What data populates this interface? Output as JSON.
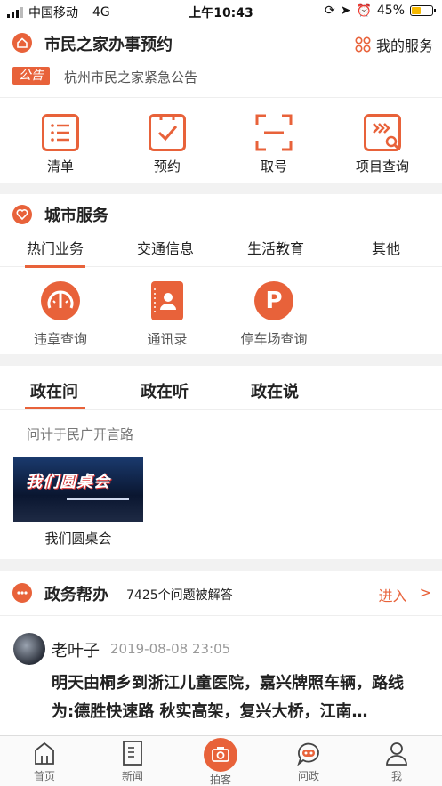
{
  "status_bar": {
    "carrier": "中国移动",
    "network": "4G",
    "time": "上午10:43",
    "battery": "45%"
  },
  "header": {
    "title": "市民之家办事预约",
    "my_services": "我的服务"
  },
  "notice": {
    "badge": "公告",
    "text": "杭州市民之家紧急公告"
  },
  "quick_actions": [
    {
      "label": "清单",
      "icon": "list-icon"
    },
    {
      "label": "预约",
      "icon": "calendar-check-icon"
    },
    {
      "label": "取号",
      "icon": "scan-icon"
    },
    {
      "label": "项目查询",
      "icon": "search-doc-icon"
    }
  ],
  "city_services": {
    "title": "城市服务",
    "tabs": [
      "热门业务",
      "交通信息",
      "生活教育",
      "其他"
    ],
    "items": [
      {
        "label": "违章查询",
        "icon": "speedometer-icon"
      },
      {
        "label": "通讯录",
        "icon": "contacts-icon"
      },
      {
        "label": "停车场查询",
        "icon": "parking-icon"
      }
    ]
  },
  "gov_tabs": [
    "政在问",
    "政在听",
    "政在说"
  ],
  "gov_subtitle": "问计于民广开言路",
  "gov_card": {
    "label": "我们圆桌会",
    "image_text": "我们圆桌会"
  },
  "gov_help": {
    "title": "政务帮办",
    "count": "7425个问题被解答",
    "enter": "进入",
    "arrow": ">"
  },
  "post": {
    "author": "老叶子",
    "time": "2019-08-08 23:05",
    "content": "明天由桐乡到浙江儿童医院，嘉兴牌照车辆，路线为:德胜快速路 秋实高架，复兴大桥，江南…"
  },
  "bottom_nav": [
    {
      "label": "首页",
      "icon": "home-icon"
    },
    {
      "label": "新闻",
      "icon": "news-icon"
    },
    {
      "label": "拍客",
      "icon": "camera-icon"
    },
    {
      "label": "问政",
      "icon": "chat-icon"
    },
    {
      "label": "我",
      "icon": "user-icon"
    }
  ],
  "colors": {
    "accent": "#e8623a",
    "battery": "#f5b800"
  }
}
